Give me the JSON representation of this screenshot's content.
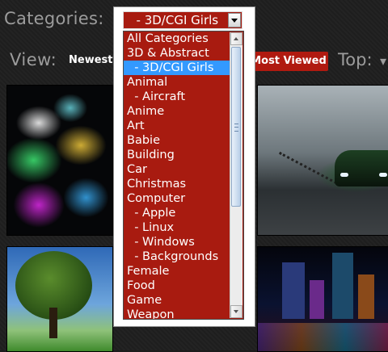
{
  "header": {
    "categories_label": "Categories:",
    "view_label": "View:",
    "view_newest": "Newest",
    "view_most_viewed": "Most Viewed",
    "top_label": "Top:",
    "top_arrow_icon": "chevron-down-icon"
  },
  "category_select": {
    "selected_value": "  - 3D/CGI Girls",
    "arrow_icon": "chevron-down-icon",
    "options": [
      "All Categories",
      "3D & Abstract",
      "  - 3D/CGI Girls",
      "Animal",
      "  - Aircraft",
      "Anime",
      "Art",
      "Babie",
      "Building",
      "Car",
      "Christmas",
      "Computer",
      "  - Apple",
      "  - Linux",
      "  - Windows",
      "  - Backgrounds",
      "Female",
      "Food",
      "Game",
      "Weapon"
    ],
    "selected_index": 2
  },
  "colors": {
    "accent_red": "#a81b10",
    "highlight_blue": "#3399ff",
    "label_grey": "#9c9c9c",
    "background": "#1e1e1e"
  }
}
